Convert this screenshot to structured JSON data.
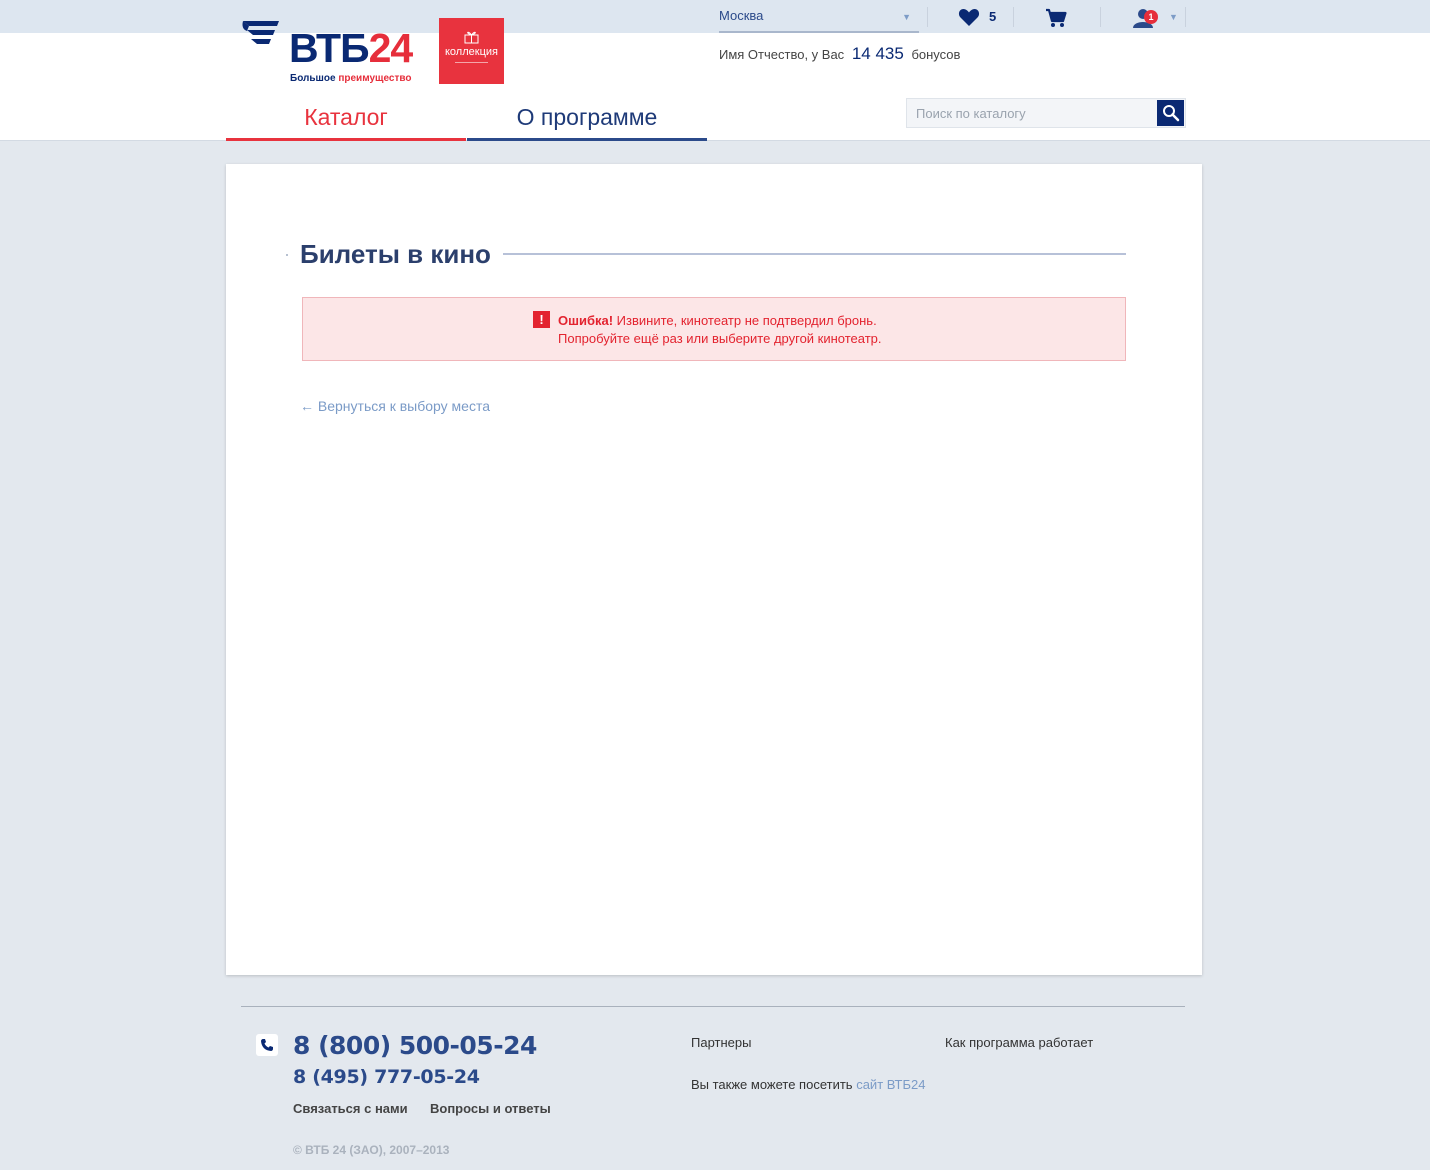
{
  "header": {
    "logo": {
      "brand_main": "ВТБ",
      "brand_num": "24",
      "slogan_a": "Большое ",
      "slogan_b": "преимущество"
    },
    "collection_label": "коллекция",
    "city": "Москва",
    "favorites_count": "5",
    "user_notifications": "1",
    "bonus": {
      "prefix": "Имя Отчество, у Вас",
      "amount": "14 435",
      "suffix": "бонусов"
    },
    "nav": {
      "catalog": "Каталог",
      "about": "О программе"
    },
    "search": {
      "placeholder": "Поиск по каталогу"
    },
    "colors": {
      "brand_blue": "#0a2973",
      "brand_red": "#e8333e"
    },
    "icons": [
      "wing-logo-icon",
      "gift-icon",
      "heart-icon",
      "cart-icon",
      "user-icon",
      "search-icon"
    ]
  },
  "main": {
    "title": "Билеты в кино",
    "error": {
      "label": "Ошибка!",
      "line1": "Извините, кинотеатр не подтвердил бронь.",
      "line2": "Попробуйте ещё раз или выберите другой кинотеатр."
    },
    "back_link": "← Вернуться к выбору места"
  },
  "footer": {
    "phone_primary": "8 (800) 500-05-24",
    "phone_secondary": "8 (495) 777-05-24",
    "links": {
      "contact": "Связаться с нами",
      "faq": "Вопросы и ответы",
      "partners": "Партнеры",
      "how_it_works": "Как программа работает"
    },
    "visit": {
      "text": "Вы также можете посетить",
      "link": "сайт ВТБ24"
    },
    "copyright": "© ВТБ 24 (ЗАО), 2007–2013"
  }
}
